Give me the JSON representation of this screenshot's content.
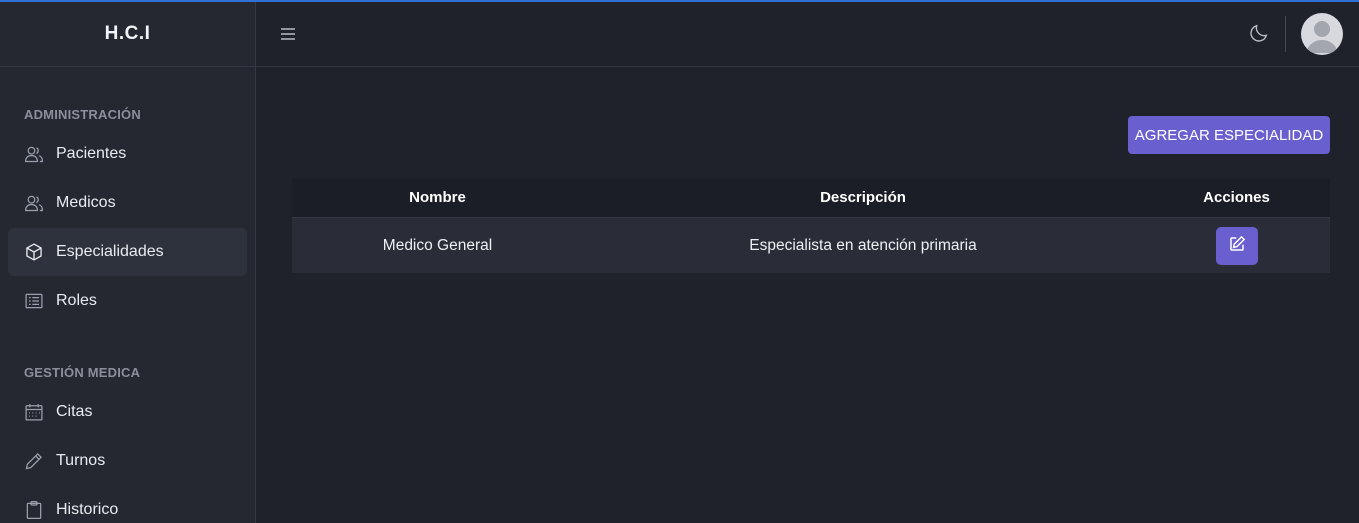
{
  "app": {
    "brand": "H.C.I"
  },
  "sidebar": {
    "sections": [
      {
        "title": "ADMINISTRACIÓN",
        "items": [
          {
            "label": "Pacientes",
            "icon": "users-icon"
          },
          {
            "label": "Medicos",
            "icon": "users-icon"
          },
          {
            "label": "Especialidades",
            "icon": "hexagon-icon",
            "active": true
          },
          {
            "label": "Roles",
            "icon": "list-icon"
          }
        ]
      },
      {
        "title": "GESTIÓN MEDICA",
        "items": [
          {
            "label": "Citas",
            "icon": "calendar-icon"
          },
          {
            "label": "Turnos",
            "icon": "pencil-icon"
          },
          {
            "label": "Historico",
            "icon": "clipboard-icon"
          }
        ]
      }
    ]
  },
  "header": {
    "menu_icon": "hamburger-icon",
    "theme_icon": "moon-icon",
    "avatar_icon": "user-avatar-icon"
  },
  "main": {
    "add_button": "AGREGAR ESPECIALIDAD",
    "table": {
      "columns": [
        "Nombre",
        "Descripción",
        "Acciones"
      ],
      "rows": [
        {
          "nombre": "Medico General",
          "descripcion": "Especialista en atención primaria",
          "action_icon": "edit-icon"
        }
      ]
    }
  },
  "colors": {
    "accent": "#6a5fcf",
    "background": "#1f222b",
    "sidebar": "#252830",
    "topline": "#2f6fd6"
  }
}
